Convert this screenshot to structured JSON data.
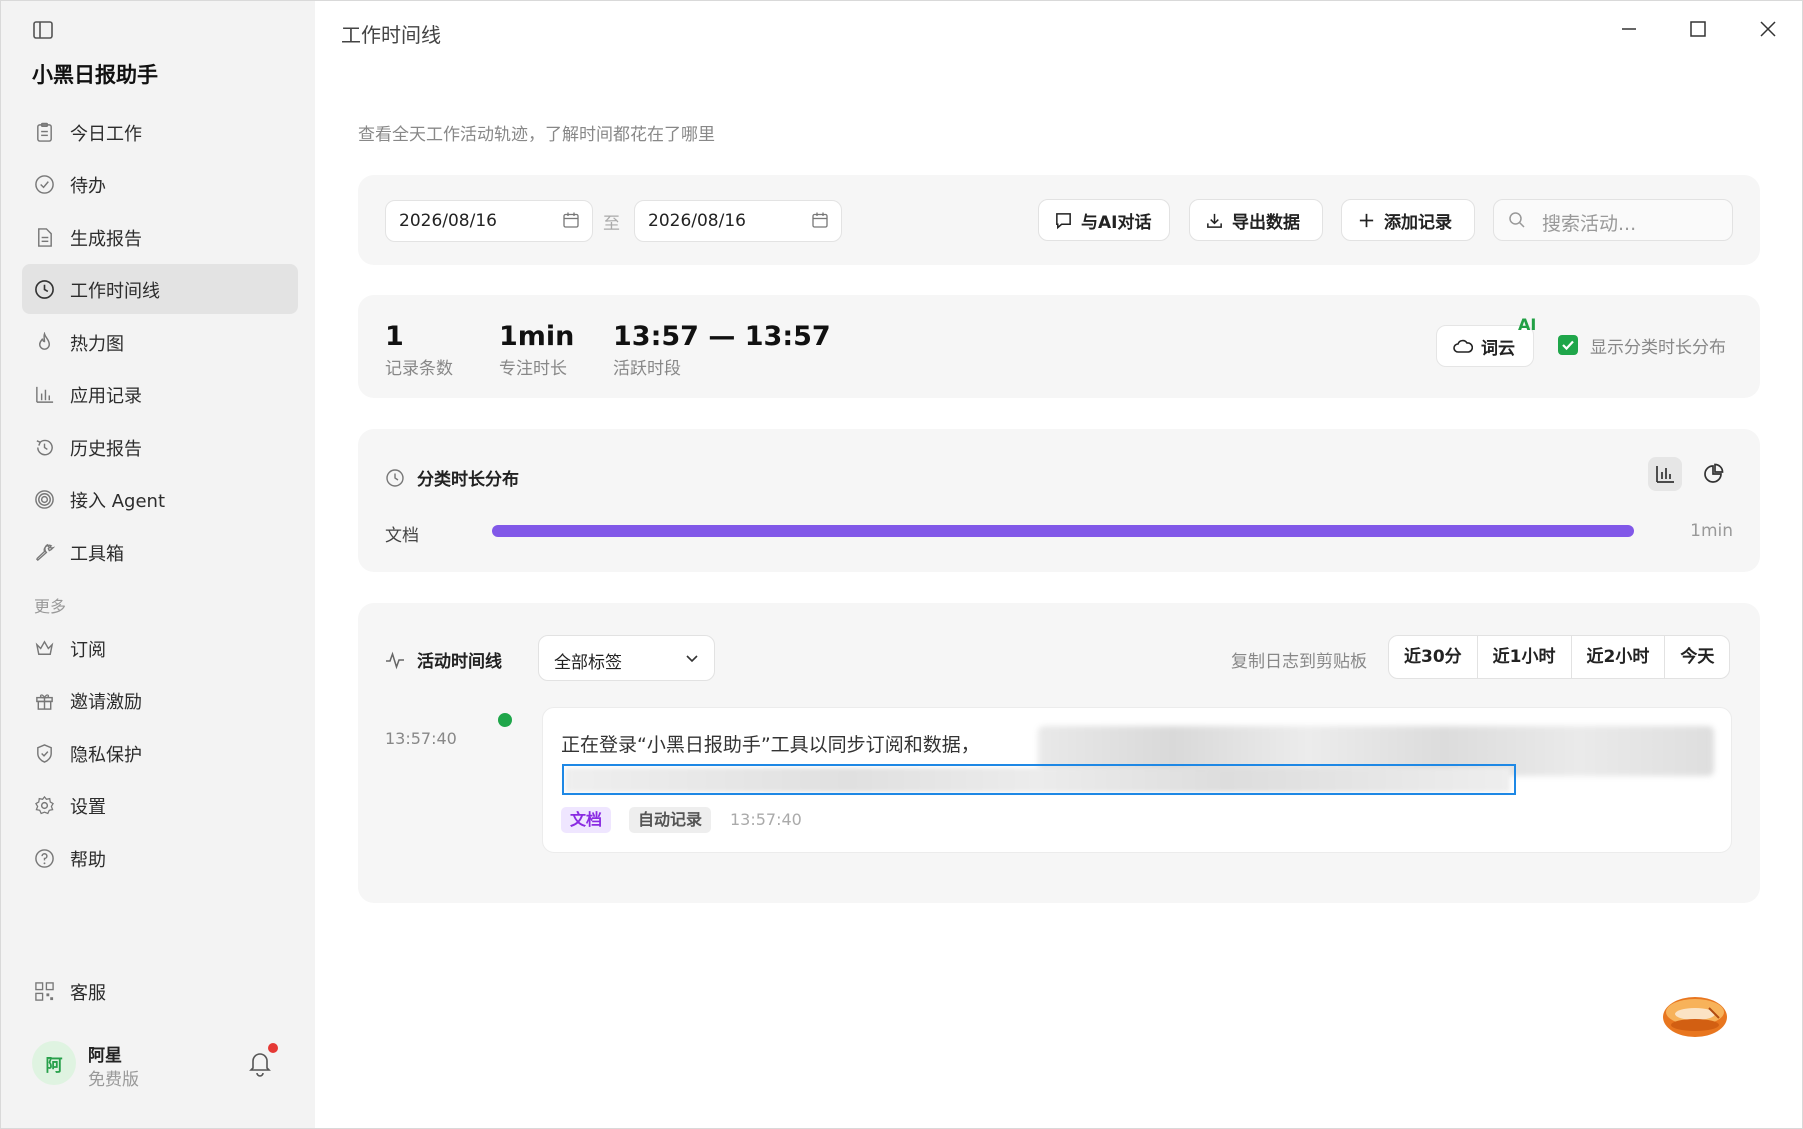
{
  "window": {
    "title": "工作时间线"
  },
  "sidebar": {
    "app_name": "小黑日报助手",
    "items": [
      {
        "label": "今日工作",
        "icon": "clipboard-icon"
      },
      {
        "label": "待办",
        "icon": "check-circle-icon"
      },
      {
        "label": "生成报告",
        "icon": "document-icon"
      },
      {
        "label": "工作时间线",
        "icon": "clock-icon",
        "active": true
      },
      {
        "label": "热力图",
        "icon": "flame-icon"
      },
      {
        "label": "应用记录",
        "icon": "bar-chart-icon"
      },
      {
        "label": "历史报告",
        "icon": "history-icon"
      },
      {
        "label": "接入 Agent",
        "icon": "spiral-icon"
      },
      {
        "label": "工具箱",
        "icon": "wrench-icon"
      }
    ],
    "more_label": "更多",
    "more_items": [
      {
        "label": "订阅",
        "icon": "crown-icon"
      },
      {
        "label": "邀请激励",
        "icon": "gift-icon"
      },
      {
        "label": "隐私保护",
        "icon": "shield-icon"
      },
      {
        "label": "设置",
        "icon": "gear-icon"
      },
      {
        "label": "帮助",
        "icon": "help-circle-icon"
      }
    ],
    "support_label": "客服",
    "user": {
      "avatar_text": "阿",
      "name": "阿星",
      "plan": "免费版"
    }
  },
  "page": {
    "subtitle": "查看全天工作活动轨迹，了解时间都花在了哪里"
  },
  "toolbar": {
    "date_from": "2026/08/16",
    "date_sep": "至",
    "date_to": "2026/08/16",
    "ai_chat_label": "与AI对话",
    "export_label": "导出数据",
    "add_record_label": "添加记录",
    "search_placeholder": "搜索活动..."
  },
  "stats": {
    "records": {
      "value": "1",
      "caption": "记录条数"
    },
    "focus": {
      "value": "1min",
      "caption": "专注时长"
    },
    "active": {
      "value": "13:57 — 13:57",
      "caption": "活跃时段"
    },
    "wordcloud_label": "词云",
    "ai_badge": "AI",
    "show_distribution_label": "显示分类时长分布",
    "show_distribution_checked": true
  },
  "distribution": {
    "title": "分类时长分布",
    "rows": [
      {
        "label": "文档",
        "fraction": 1.0,
        "value": "1min",
        "color": "#8158e8"
      }
    ]
  },
  "timeline": {
    "title": "活动时间线",
    "filter_value": "全部标签",
    "copy_log_label": "复制日志到剪贴板",
    "ranges": [
      "近30分",
      "近1小时",
      "近2小时",
      "今天"
    ],
    "entries": [
      {
        "time": "13:57:40",
        "text": "正在登录“小黑日报助手”工具以同步订阅和数据，",
        "tag_category": "文档",
        "tag_source": "自动记录",
        "timestamp": "13:57:40"
      }
    ]
  }
}
